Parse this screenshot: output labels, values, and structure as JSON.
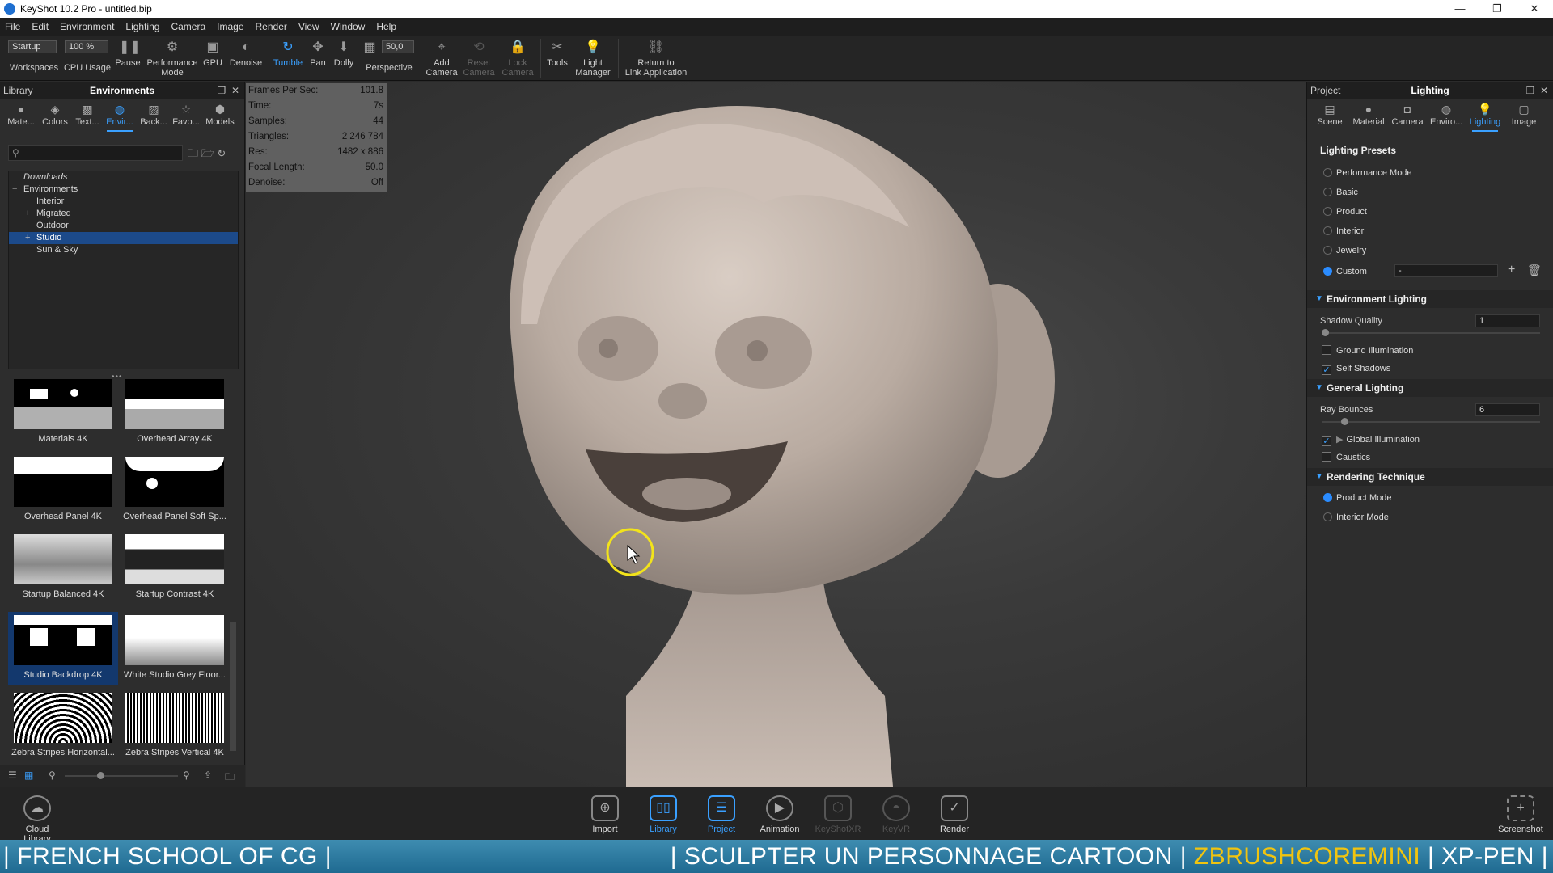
{
  "window": {
    "title": "KeyShot 10.2 Pro - untitled.bip",
    "controls": [
      "—",
      "❐",
      "✕"
    ]
  },
  "menu": [
    "File",
    "Edit",
    "Environment",
    "Lighting",
    "Camera",
    "Image",
    "Render",
    "View",
    "Window",
    "Help"
  ],
  "toolbar": {
    "workspace_value": "Startup",
    "cpu_value": "100 %",
    "fov_value": "50,0",
    "items": [
      {
        "label": "Workspaces"
      },
      {
        "label": "CPU Usage"
      },
      {
        "label": "Pause"
      },
      {
        "label": "Performance\nMode"
      },
      {
        "label": "GPU"
      },
      {
        "label": "Denoise"
      },
      {
        "label": "Tumble"
      },
      {
        "label": "Pan"
      },
      {
        "label": "Dolly"
      },
      {
        "label": "Perspective"
      },
      {
        "label": "Add\nCamera"
      },
      {
        "label": "Reset\nCamera"
      },
      {
        "label": "Lock\nCamera"
      },
      {
        "label": "Tools"
      },
      {
        "label": "Light\nManager"
      },
      {
        "label": "Return to\nLink Application"
      }
    ]
  },
  "library": {
    "header_left": "Library",
    "header_title": "Environments",
    "tabs": [
      "Mate...",
      "Colors",
      "Text...",
      "Envir...",
      "Back...",
      "Favo...",
      "Models"
    ],
    "tree": [
      {
        "label": "Downloads",
        "indent": 0
      },
      {
        "label": "Environments",
        "indent": 0
      },
      {
        "label": "Interior",
        "indent": 1
      },
      {
        "label": "Migrated",
        "indent": 1
      },
      {
        "label": "Outdoor",
        "indent": 1
      },
      {
        "label": "Studio",
        "indent": 1
      },
      {
        "label": "Sun & Sky",
        "indent": 1
      }
    ],
    "thumbnails": [
      "Materials 4K",
      "Overhead Array 4K",
      "Overhead Panel 4K",
      "Overhead Panel Soft Sp...",
      "Startup Balanced 4K",
      "Startup Contrast 4K",
      "Studio Backdrop 4K",
      "White Studio Grey Floor...",
      "Zebra Stripes Horizontal...",
      "Zebra Stripes Vertical 4K"
    ]
  },
  "hud": {
    "rows": [
      {
        "label": "Frames Per Sec:",
        "value": "101.8"
      },
      {
        "label": "Time:",
        "value": "7s"
      },
      {
        "label": "Samples:",
        "value": "44"
      },
      {
        "label": "Triangles:",
        "value": "2 246 784"
      },
      {
        "label": "Res:",
        "value": "1482 x 886"
      },
      {
        "label": "Focal Length:",
        "value": "50.0"
      },
      {
        "label": "Denoise:",
        "value": "Off"
      }
    ]
  },
  "project": {
    "header_left": "Project",
    "header_title": "Lighting",
    "tabs": [
      "Scene",
      "Material",
      "Camera",
      "Enviro...",
      "Lighting",
      "Image"
    ],
    "presets_title": "Lighting Presets",
    "presets": [
      "Performance Mode",
      "Basic",
      "Product",
      "Interior",
      "Jewelry",
      "Custom"
    ],
    "custom_value": "-",
    "env_lighting": {
      "title": "Environment Lighting",
      "shadow_quality_label": "Shadow Quality",
      "shadow_quality_value": "1",
      "ground_illumination": "Ground Illumination",
      "self_shadows": "Self Shadows"
    },
    "general_lighting": {
      "title": "General Lighting",
      "ray_bounces_label": "Ray Bounces",
      "ray_bounces_value": "6",
      "global_illumination": "Global Illumination",
      "caustics": "Caustics"
    },
    "rendering_technique": {
      "title": "Rendering Technique",
      "options": [
        "Product Mode",
        "Interior Mode"
      ]
    }
  },
  "bottombar": {
    "cloud_library": "Cloud Library",
    "items": [
      "Import",
      "Library",
      "Project",
      "Animation",
      "KeyShotXR",
      "KeyVR",
      "Render"
    ],
    "screenshot": "Screenshot"
  },
  "banner": {
    "left": "| FRENCH SCHOOL OF CG |",
    "right_a": "| SCULPTER UN PERSONNAGE CARTOON |",
    "right_b": "ZBRUSHCOREMINI",
    "right_c": "| XP-PEN |"
  },
  "colors": {
    "accent": "#3aa0ff",
    "selection": "#1c4a8a",
    "banner": "#2a7aa3",
    "highlight_ring": "#f2e31b"
  }
}
